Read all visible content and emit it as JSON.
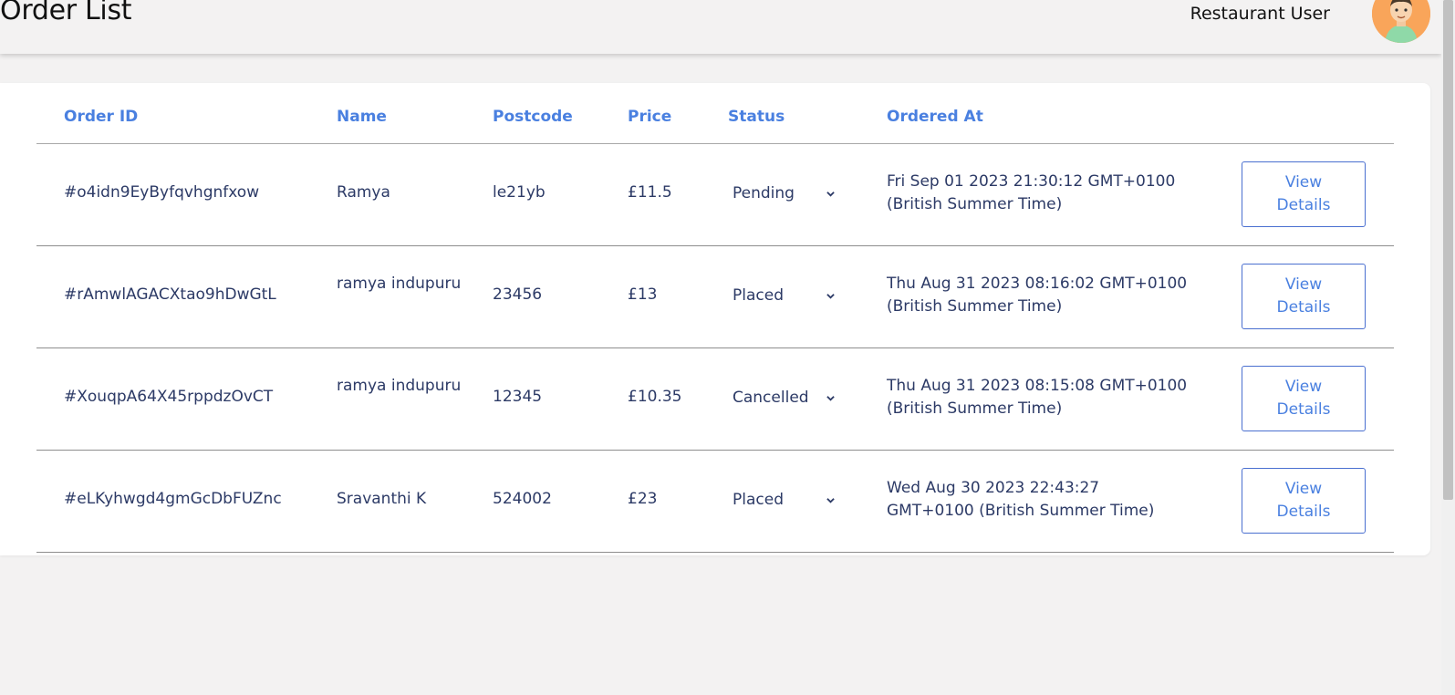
{
  "header": {
    "title": "Order List",
    "user_name": "Restaurant User"
  },
  "table": {
    "columns": [
      "Order ID",
      "Name",
      "Postcode",
      "Price",
      "Status",
      "Ordered At"
    ],
    "rows": [
      {
        "order_id": "#o4idn9EyByfqvhgnfxow",
        "name": "Ramya",
        "postcode": "le21yb",
        "price": "£11.5",
        "status": "Pending",
        "ordered_at": "Fri Sep 01 2023 21:30:12 GMT+0100 (British Summer Time)",
        "action": "View Details"
      },
      {
        "order_id": "#rAmwlAGACXtao9hDwGtL",
        "name": "ramya indupuru",
        "postcode": "23456",
        "price": "£13",
        "status": "Placed",
        "ordered_at": "Thu Aug 31 2023 08:16:02 GMT+0100 (British Summer Time)",
        "action": "View Details"
      },
      {
        "order_id": "#XouqpA64X45rppdzOvCT",
        "name": "ramya indupuru",
        "postcode": "12345",
        "price": "£10.35",
        "status": "Cancelled",
        "ordered_at": "Thu Aug 31 2023 08:15:08 GMT+0100 (British Summer Time)",
        "action": "View Details"
      },
      {
        "order_id": "#eLKyhwgd4gmGcDbFUZnc",
        "name": "Sravanthi K",
        "postcode": "524002",
        "price": "£23",
        "status": "Placed",
        "ordered_at": "Wed Aug 30 2023 22:43:27 GMT+0100 (British Summer Time)",
        "action": "View Details"
      }
    ]
  },
  "icons": {
    "avatar": "avatar",
    "status_dropdown": "chevron-down-icon"
  },
  "colors": {
    "accent": "#4a80e0",
    "text": "#2c3a66",
    "background": "#f3f2f2",
    "avatar_bg": "#f9a55a"
  }
}
